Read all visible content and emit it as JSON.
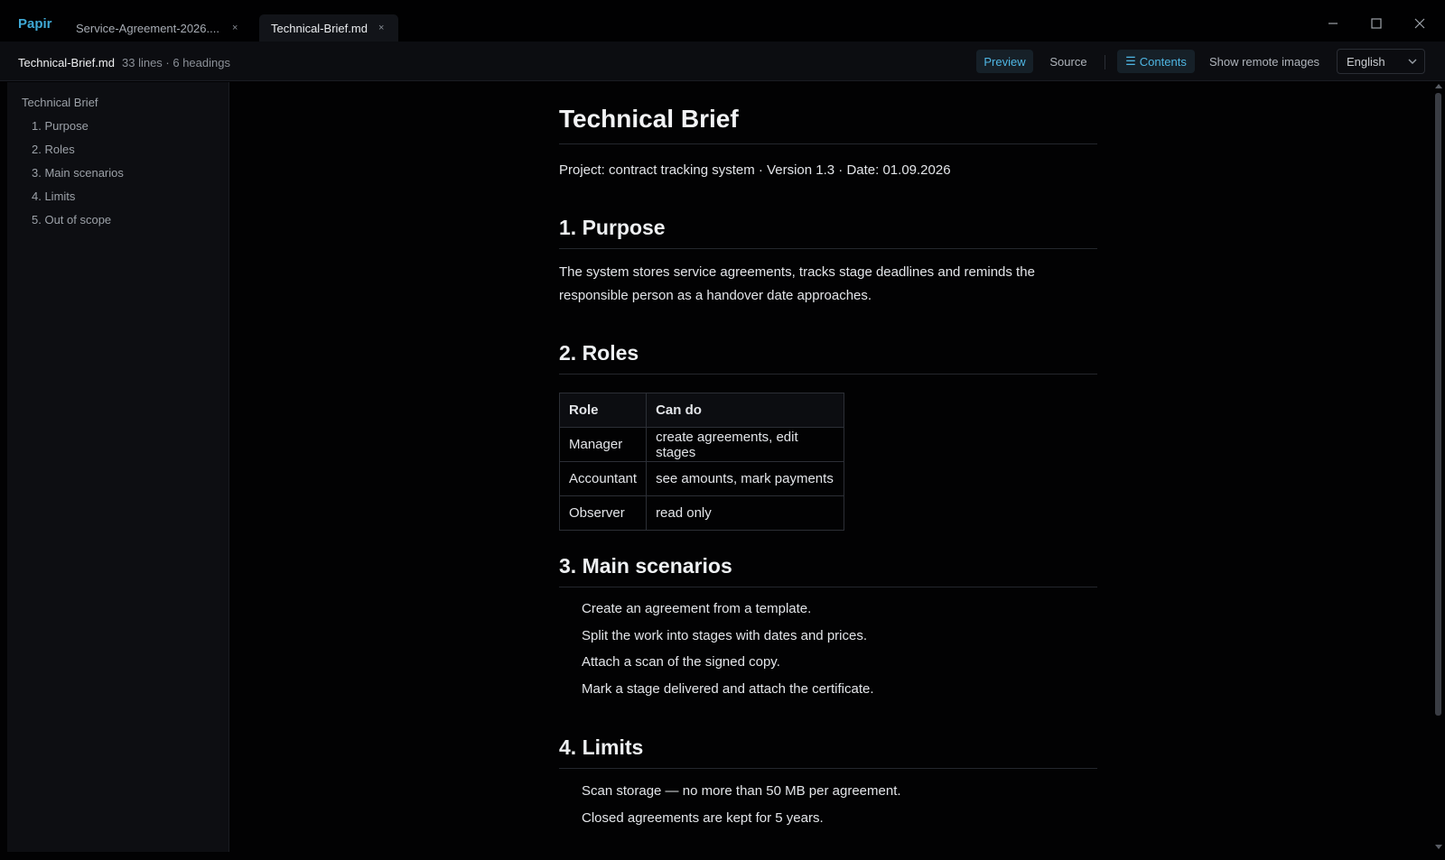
{
  "app": {
    "name": "Papir",
    "tabs": [
      {
        "label": "Service-Agreement-2026....",
        "close": "×",
        "active": false
      },
      {
        "label": "Technical-Brief.md",
        "close": "×",
        "active": true
      }
    ],
    "window_controls": [
      "minimize-icon",
      "maximize-icon",
      "close-icon"
    ]
  },
  "toolbar": {
    "file_name": "Technical-Brief.md",
    "file_meta": "33 lines · 6 headings",
    "preview_label": "Preview",
    "source_label": "Source",
    "contents_glyph": "☰",
    "contents_label": "Contents",
    "remote_images_label": "Show remote images",
    "language_value": "English"
  },
  "sidebar": {
    "root": "Technical Brief",
    "items": [
      "1. Purpose",
      "2. Roles",
      "3. Main scenarios",
      "4. Limits",
      "5. Out of scope"
    ]
  },
  "document": {
    "title": "Technical Brief",
    "meta_line": "Project: contract tracking system · Version 1.3 · Date: 01.09.2026",
    "sections": {
      "purpose": {
        "heading": "1. Purpose",
        "line1": "The system stores service agreements, tracks stage deadlines and reminds the",
        "line2": "responsible person as a handover date approaches."
      },
      "roles": {
        "heading": "2. Roles",
        "headers": [
          "Role",
          "Can do"
        ],
        "rows": [
          [
            "Manager",
            "create agreements, edit stages"
          ],
          [
            "Accountant",
            "see amounts, mark payments"
          ],
          [
            "Observer",
            "read only"
          ]
        ]
      },
      "scenarios": {
        "heading": "3. Main scenarios",
        "items": [
          "Create an agreement from a template.",
          "Split the work into stages with dates and prices.",
          "Attach a scan of the signed copy.",
          "Mark a stage delivered and attach the certificate."
        ]
      },
      "limits": {
        "heading": "4. Limits",
        "items": [
          "Scan storage — no more than 50 MB per agreement.",
          "Closed agreements are kept for 5 years."
        ]
      }
    }
  },
  "colors": {
    "accent": "#4fb6e3",
    "background": "#020203",
    "sidebar_background": "#0d0e12"
  }
}
